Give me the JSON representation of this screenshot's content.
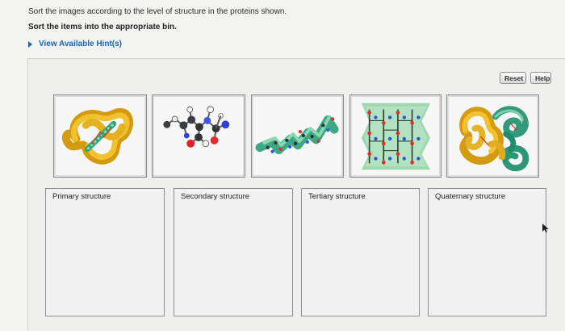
{
  "prompt": "Sort the images according to the level of structure in the proteins shown.",
  "instruction": "Sort the items into the appropriate bin.",
  "hint_link": "View Available Hint(s)",
  "buttons": {
    "reset": "Reset",
    "help": "Help"
  },
  "bins": [
    {
      "label": "Primary structure"
    },
    {
      "label": "Secondary structure"
    },
    {
      "label": "Tertiary structure"
    },
    {
      "label": "Quaternary structure"
    }
  ],
  "icons": {
    "hint": "chevron-right-icon",
    "pointer": "mouse-pointer-icon"
  }
}
